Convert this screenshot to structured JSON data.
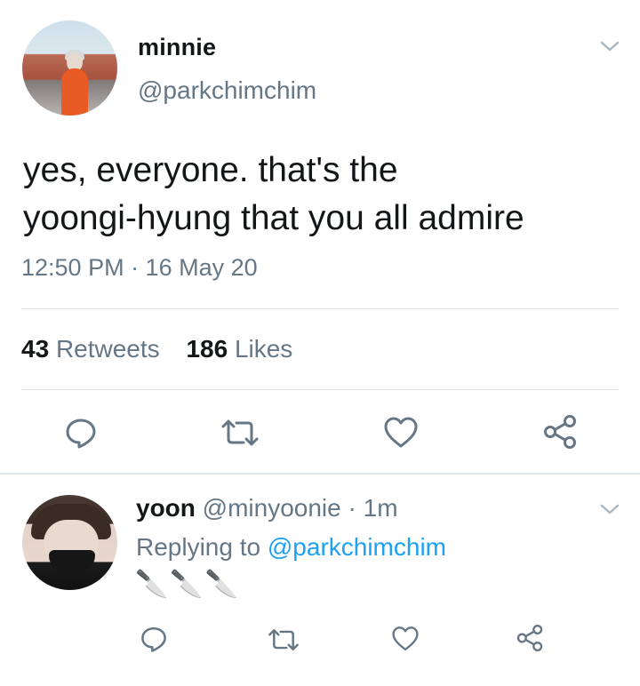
{
  "tweet": {
    "display_name": "minnie",
    "handle": "@parkchimchim",
    "text_line1": "yes, everyone. that's the",
    "text_line2": "yoongi-hyung that you all admire",
    "timestamp": "12:50 PM · 16 May 20",
    "retweets_count": "43",
    "retweets_label": "Retweets",
    "likes_count": "186",
    "likes_label": "Likes",
    "icons": [
      "reply-icon",
      "retweet-icon",
      "like-icon",
      "share-icon",
      "chevron-down-icon"
    ]
  },
  "reply": {
    "display_name": "yoon",
    "handle": "@minyoonie",
    "separator": " · ",
    "time": "1m",
    "replying_prefix": "Replying to ",
    "replying_to": "@parkchimchim",
    "text": "🔪🔪🔪",
    "icons": [
      "reply-icon",
      "retweet-icon",
      "like-icon",
      "share-icon",
      "chevron-down-icon"
    ]
  },
  "colors": {
    "text_primary": "#14171a",
    "text_secondary": "#657786",
    "link": "#1da1f2",
    "divider": "#dfe4e7"
  }
}
